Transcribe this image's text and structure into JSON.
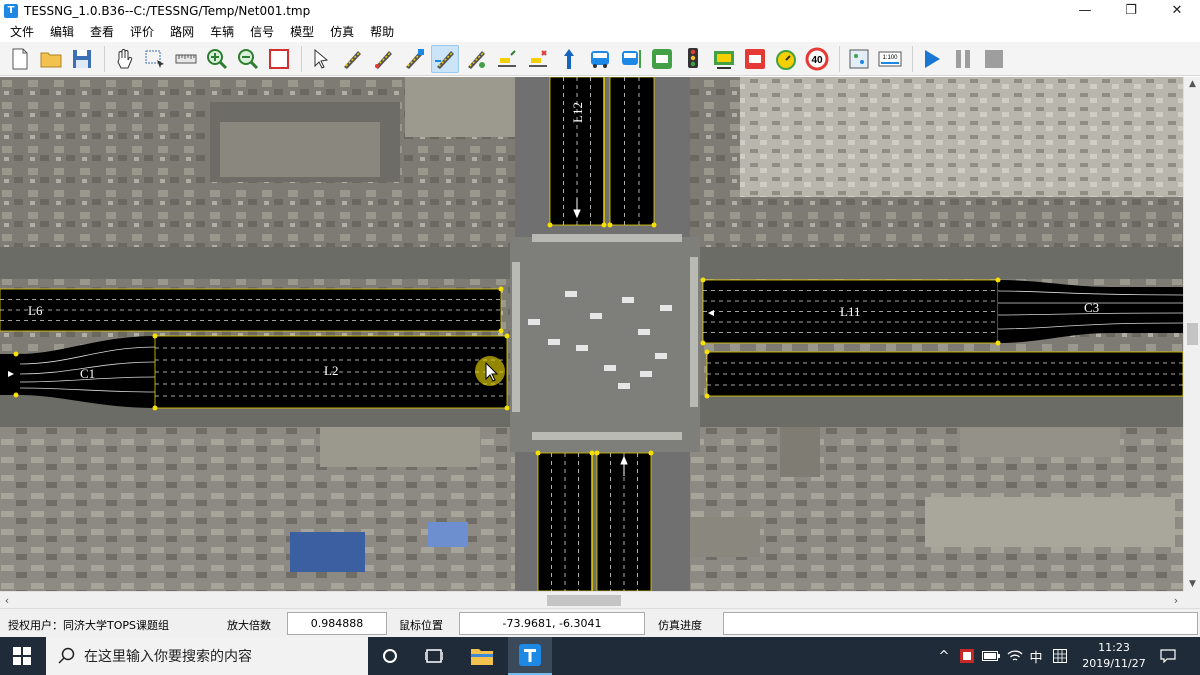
{
  "window": {
    "title": "TESSNG_1.0.B36--C:/TESSNG/Temp/Net001.tmp",
    "app_icon": "tessng-app-icon",
    "controls": [
      "minimize-icon",
      "maximize-icon",
      "close-icon"
    ]
  },
  "menu": [
    "文件",
    "编辑",
    "查看",
    "评价",
    "路网",
    "车辆",
    "信号",
    "模型",
    "仿真",
    "帮助"
  ],
  "toolbar": {
    "scale_label": "1:100",
    "speed_limit_label": "40",
    "active_tool": "link-tool-icon",
    "groups": [
      [
        "new-file-icon",
        "open-folder-icon",
        "save-icon"
      ],
      [
        "pan-hand-icon",
        "select-zoom-icon",
        "measure-ruler-icon",
        "zoom-in-icon",
        "zoom-out-icon",
        "fit-view-icon"
      ],
      [
        "pointer-icon",
        "road-tool-icon",
        "connector-tool-icon",
        "lane-tool-icon",
        "link-tool-icon",
        "road-edit-icon",
        "vehicle-input-icon",
        "route-icon",
        "direction-arrow-icon",
        "bus-line-icon",
        "bus-stop-icon",
        "vehicle-type-icon",
        "signal-light-icon",
        "detector-icon",
        "parking-icon",
        "timer-icon",
        "speed-limit-icon"
      ],
      [
        "layer-icon",
        "scale-icon"
      ],
      [
        "play-icon",
        "pause-icon",
        "stop-icon"
      ]
    ]
  },
  "map": {
    "link_labels": {
      "L6": "L6",
      "L2": "L2",
      "C1": "C1",
      "L11": "L11",
      "C3": "C3",
      "L12": "L12"
    },
    "colors": {
      "road": "#000000",
      "lane_marking": "#d9d9d9",
      "road_border": "#e8d200",
      "label": "#ffffff"
    }
  },
  "status": {
    "user_label": "授权用户：同济大学TOPS课题组",
    "zoom_label": "放大倍数",
    "zoom_value": "0.984888",
    "mouse_label": "鼠标位置",
    "mouse_value": "-73.9681, -6.3041",
    "progress_label": "仿真进度",
    "progress_value": ""
  },
  "taskbar": {
    "search_placeholder": "在这里输入你要搜索的内容",
    "time": "11:23",
    "date": "2019/11/27",
    "ime_label": "中"
  }
}
